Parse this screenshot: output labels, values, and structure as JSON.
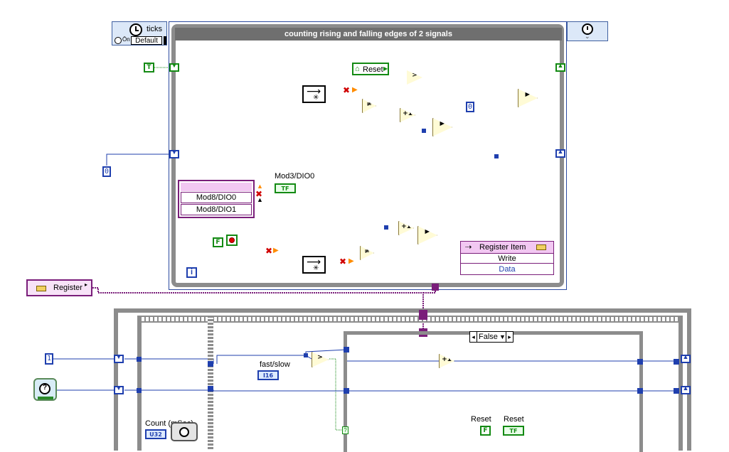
{
  "timed_loop": {
    "title": "counting rising and falling edges of 2 signals",
    "ticks_label": "ticks",
    "default_label": "Default",
    "iteration_terminal": "i"
  },
  "constants": {
    "bool_true": "T",
    "bool_false": "F",
    "zero_a": "0",
    "zero_b": "0",
    "one": "1",
    "reset_false": "F"
  },
  "indicators": {
    "tf_text": "TF",
    "mod3_label": "Mod3/DIO0",
    "fast_slow_label": "fast/slow",
    "fast_slow_type": "I16",
    "count_label": "Count (mSec)",
    "count_type": "U32",
    "reset_label_a": "Reset",
    "reset_label_b": "Reset"
  },
  "io_node": {
    "items": [
      "Mod8/DIO0",
      "Mod8/DIO1"
    ]
  },
  "register": {
    "control_label": "Register",
    "reset_property": "Reset",
    "node_title": "Register Item",
    "node_rows": [
      "Write",
      "Data"
    ]
  },
  "case_structure": {
    "selector_value": "False"
  },
  "primitives": {
    "increment": "+1",
    "greater": ">",
    "not_equal": "≠",
    "select": "▶"
  },
  "colors": {
    "numeric_wire": "#1f3fae",
    "boolean_wire": "#138a13",
    "refnum_wire": "#7a1e7a",
    "loop_frame": "#8c8c8c",
    "loop_title_bar": "#6f6f6f"
  }
}
